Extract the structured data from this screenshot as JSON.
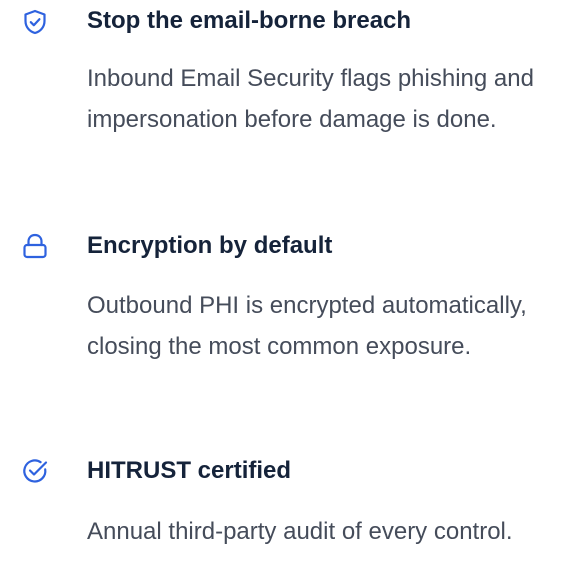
{
  "accent_color": "#2e62df",
  "features": [
    {
      "icon": "shield-check-icon",
      "title": "Stop the email-borne breach",
      "description": "Inbound Email Security flags phishing and impersonation before damage is done."
    },
    {
      "icon": "lock-icon",
      "title": "Encryption by default",
      "description": "Outbound PHI is encrypted automatically, closing the most common exposure."
    },
    {
      "icon": "badge-check-icon",
      "title": "HITRUST certified",
      "description": "Annual third-party audit of every control."
    }
  ]
}
